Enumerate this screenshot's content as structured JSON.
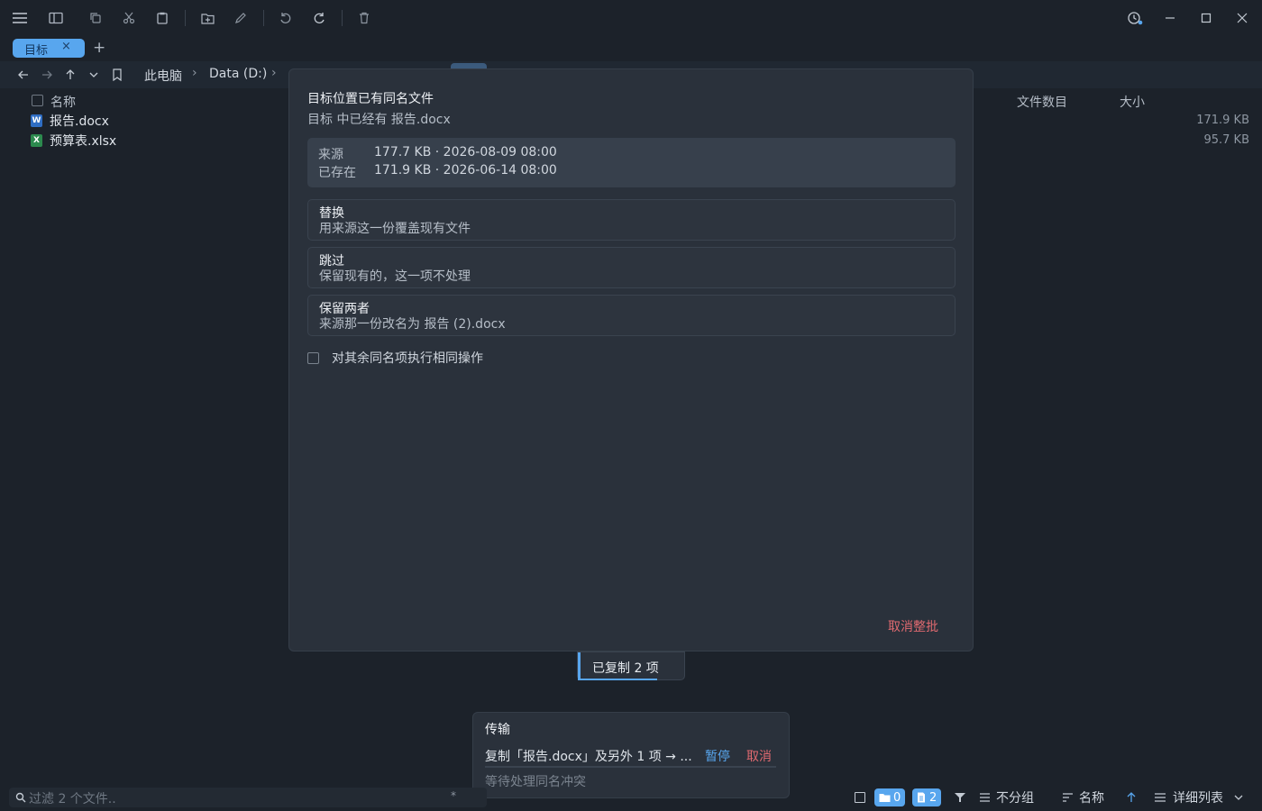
{
  "tabs": [
    {
      "label": "目标",
      "close": "×"
    }
  ],
  "tab_add": "+",
  "breadcrumb": [
    "此电脑",
    "Data (D:)"
  ],
  "breadcrumb_sep": "›",
  "columns": {
    "name": "名称",
    "file_count": "文件数目",
    "size": "大小"
  },
  "files": [
    {
      "name": "报告.docx",
      "size": "171.9 KB",
      "type": "word"
    },
    {
      "name": "预算表.xlsx",
      "size": "95.7 KB",
      "type": "excel"
    }
  ],
  "dialog": {
    "title": "目标位置已有同名文件",
    "subtitle": "目标 中已经有 报告.docx",
    "source_label": "来源",
    "source_value": "177.7 KB · 2026-08-09 08:00",
    "existing_label": "已存在",
    "existing_value": "171.9 KB · 2026-06-14 08:00",
    "options": [
      {
        "title": "替换",
        "desc": "用来源这一份覆盖现有文件"
      },
      {
        "title": "跳过",
        "desc": "保留现有的，这一项不处理"
      },
      {
        "title": "保留两者",
        "desc": "来源那一份改名为 报告 (2).docx"
      }
    ],
    "apply_all": "对其余同名项执行相同操作",
    "cancel_batch": "取消整批"
  },
  "toast": {
    "text": "已复制 2 项"
  },
  "transfer": {
    "title": "传输",
    "desc": "复制「报告.docx」及另外 1 项 → ...",
    "pause": "暂停",
    "cancel": "取消",
    "status": "等待处理同名冲突"
  },
  "statusbar": {
    "filter_placeholder": "过滤 2 个文件..",
    "filter_star": "*",
    "folders_count": "0",
    "files_count": "2",
    "group": "不分组",
    "sort": "名称",
    "view": "详细列表"
  },
  "colors": {
    "accent": "#58a6ee",
    "danger": "#e06a70",
    "background": "#1c222a",
    "dialog": "#2a313b"
  }
}
